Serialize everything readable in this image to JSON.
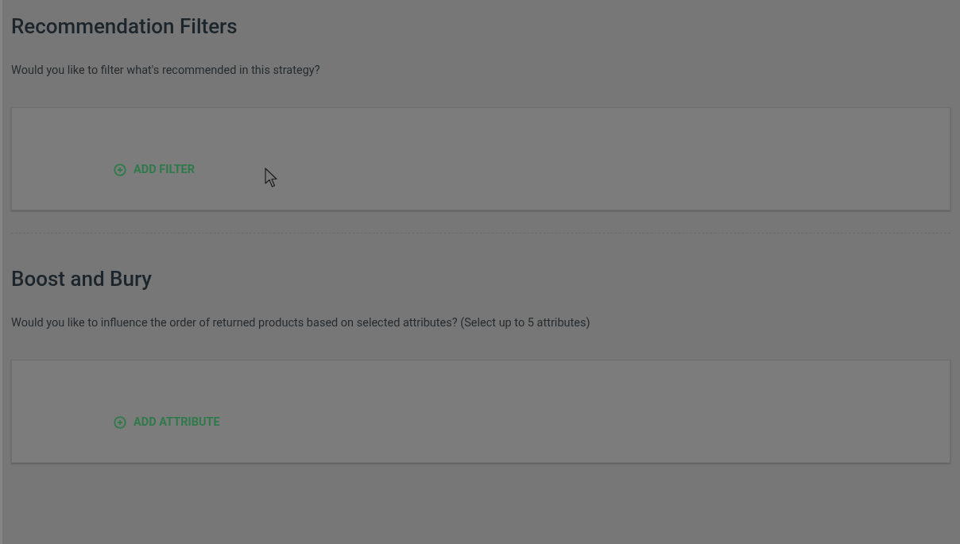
{
  "sections": [
    {
      "title": "Recommendation Filters",
      "description": "Would you like to filter what's recommended in this strategy?",
      "action": "ADD FILTER",
      "divider_after": true
    },
    {
      "title": "Boost and Bury",
      "description": "Would you like to influence the order of returned products based on selected attributes? (Select up to 5 attributes)",
      "action": "ADD ATTRIBUTE",
      "divider_after": false
    }
  ]
}
